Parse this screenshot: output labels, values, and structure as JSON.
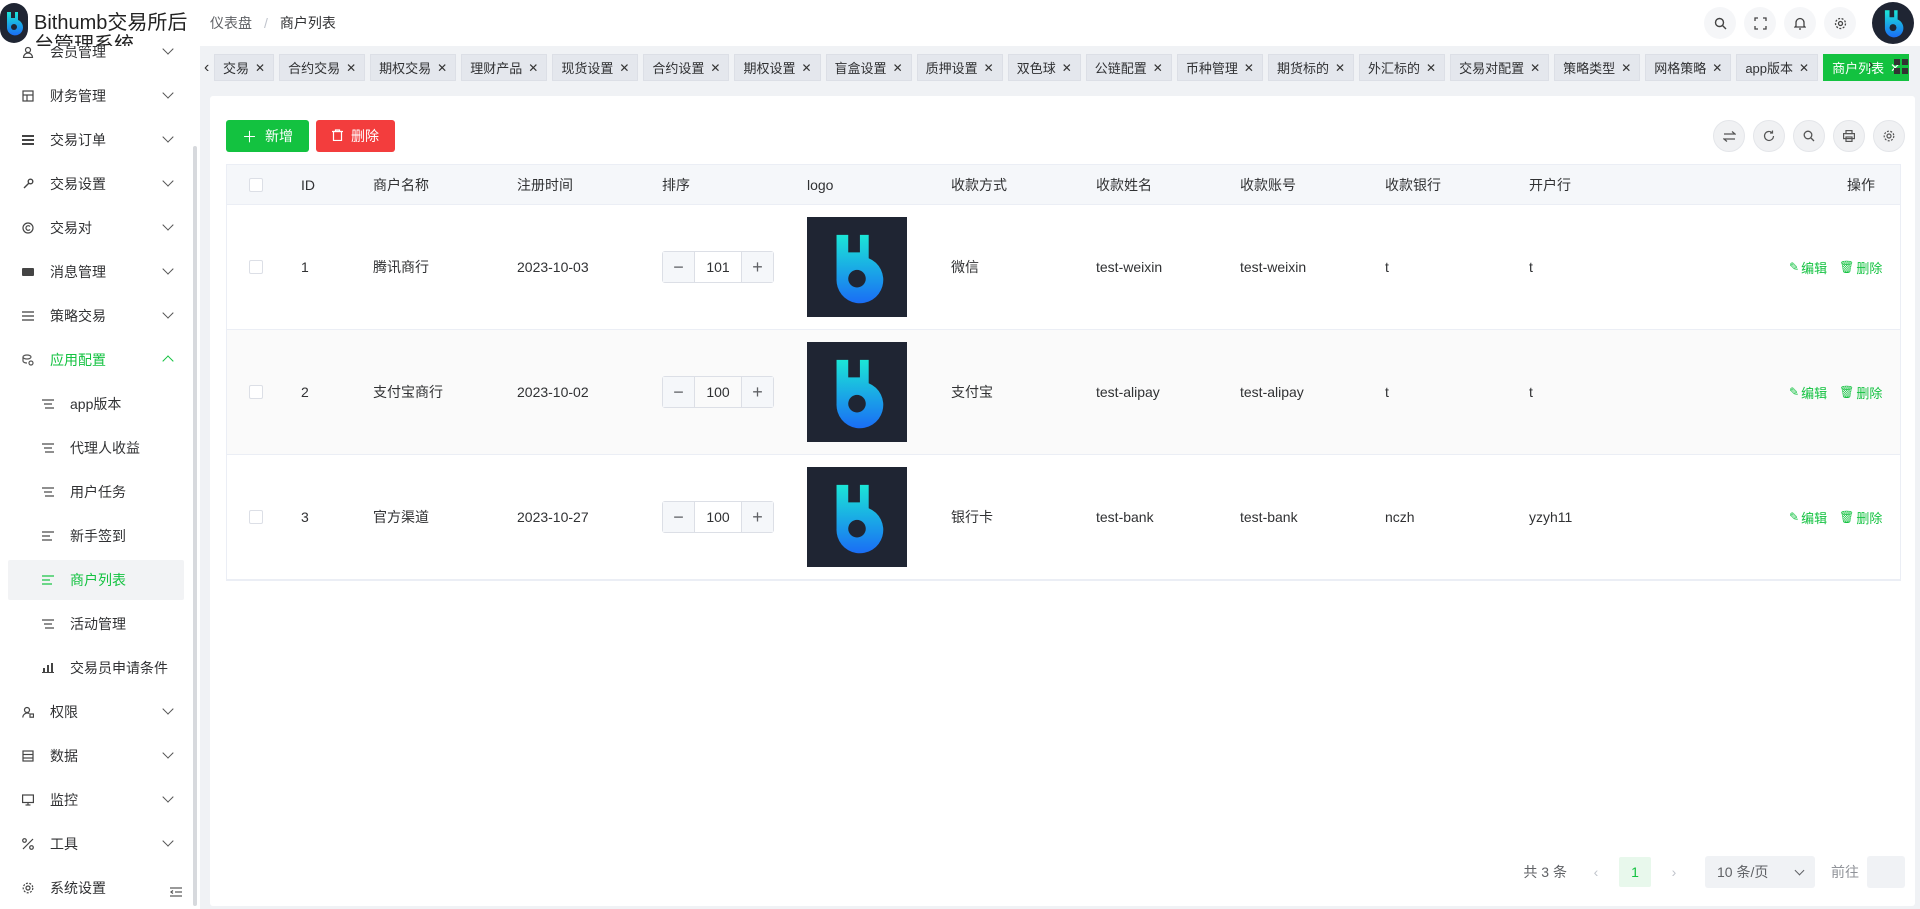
{
  "header": {
    "app_title": "Bithumb交易所后台管理系统",
    "breadcrumb": [
      "仪表盘",
      "商户列表"
    ],
    "tools": [
      "search-icon",
      "fullscreen-icon",
      "bell-icon",
      "gear-icon"
    ]
  },
  "sidebar": {
    "items": [
      {
        "label": "会员管理",
        "icon": "user-icon"
      },
      {
        "label": "财务管理",
        "icon": "finance-icon"
      },
      {
        "label": "交易订单",
        "icon": "order-icon"
      },
      {
        "label": "交易设置",
        "icon": "wrench-icon"
      },
      {
        "label": "交易对",
        "icon": "copyright-icon"
      },
      {
        "label": "消息管理",
        "icon": "message-icon"
      },
      {
        "label": "策略交易",
        "icon": "list-icon"
      },
      {
        "label": "应用配置",
        "icon": "config-icon"
      },
      {
        "label": "app版本",
        "icon": "align-icon"
      },
      {
        "label": "代理人收益",
        "icon": "align-icon"
      },
      {
        "label": "用户任务",
        "icon": "align-icon"
      },
      {
        "label": "新手签到",
        "icon": "align-left-icon"
      },
      {
        "label": "商户列表",
        "icon": "align-left-icon"
      },
      {
        "label": "活动管理",
        "icon": "align-icon"
      },
      {
        "label": "交易员申请条件",
        "icon": "bar-chart-icon"
      },
      {
        "label": "权限",
        "icon": "user-lock-icon"
      },
      {
        "label": "数据",
        "icon": "data-icon"
      },
      {
        "label": "监控",
        "icon": "monitor-icon"
      },
      {
        "label": "工具",
        "icon": "tool-icon"
      },
      {
        "label": "系统设置",
        "icon": "gear-icon"
      }
    ]
  },
  "tags": [
    "交易",
    "合约交易",
    "期权交易",
    "理财产品",
    "现货设置",
    "合约设置",
    "期权设置",
    "盲盒设置",
    "质押设置",
    "双色球",
    "公链配置",
    "币种管理",
    "期货标的",
    "外汇标的",
    "交易对配置",
    "策略类型",
    "网格策略",
    "app版本",
    "商户列表"
  ],
  "toolbar": {
    "add_label": "新增",
    "delete_label": "删除",
    "right_tools": [
      "switch-icon",
      "refresh-icon",
      "search-icon",
      "print-icon",
      "gear-icon"
    ]
  },
  "table": {
    "columns": [
      "ID",
      "商户名称",
      "注册时间",
      "排序",
      "logo",
      "收款方式",
      "收款姓名",
      "收款账号",
      "收款银行",
      "开户行",
      "操作"
    ],
    "rows": [
      {
        "id": "1",
        "name": "腾讯商行",
        "date": "2023-10-03",
        "sort": "101",
        "method": "微信",
        "payee": "test-weixin",
        "account": "test-weixin",
        "bank": "t",
        "branch": "t"
      },
      {
        "id": "2",
        "name": "支付宝商行",
        "date": "2023-10-02",
        "sort": "100",
        "method": "支付宝",
        "payee": "test-alipay",
        "account": "test-alipay",
        "bank": "t",
        "branch": "t"
      },
      {
        "id": "3",
        "name": "官方渠道",
        "date": "2023-10-27",
        "sort": "100",
        "method": "银行卡",
        "payee": "test-bank",
        "account": "test-bank",
        "bank": "nczh",
        "branch": "yzyh11"
      }
    ],
    "edit_label": "编辑",
    "delete_label": "删除"
  },
  "pagination": {
    "total": "共 3 条",
    "current": "1",
    "page_size": "10 条/页",
    "goto": "前往"
  },
  "colors": {
    "primary": "#13c240",
    "danger": "#f33d3d"
  }
}
